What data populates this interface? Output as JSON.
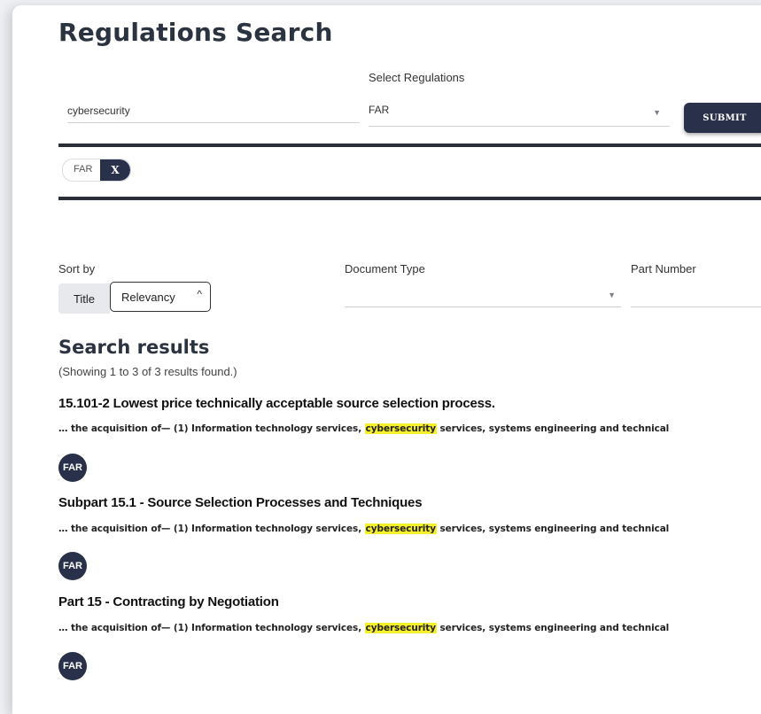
{
  "page": {
    "title": "Regulations Search"
  },
  "search": {
    "query": "cybersecurity",
    "regulations_label": "Select Regulations",
    "regulations_value": "FAR",
    "submit_label": "SUBMIT"
  },
  "filters": {
    "chips": [
      {
        "label": "FAR",
        "remove_label": "X"
      }
    ]
  },
  "sort": {
    "label": "Sort by",
    "title_option": "Title",
    "selected": "Relevancy"
  },
  "document_type": {
    "label": "Document Type",
    "value": ""
  },
  "part_number": {
    "label": "Part Number",
    "value": ""
  },
  "results": {
    "heading": "Search results",
    "summary": "(Showing 1 to 3 of 3 results found.)",
    "items": [
      {
        "title": "15.101-2 Lowest price technically acceptable source selection process.",
        "snippet_before": "… the acquisition of— (1) Information technology services, ",
        "snippet_highlight": "cybersecurity",
        "snippet_after": " services, systems engineering and technical",
        "badge": "FAR"
      },
      {
        "title": "Subpart 15.1 - Source Selection Processes and Techniques",
        "snippet_before": "… the acquisition of— (1) Information technology services, ",
        "snippet_highlight": "cybersecurity",
        "snippet_after": " services, systems engineering and technical",
        "badge": "FAR"
      },
      {
        "title": "Part 15 - Contracting by Negotiation",
        "snippet_before": "… the acquisition of— (1) Information technology services, ",
        "snippet_highlight": "cybersecurity",
        "snippet_after": " services, systems engineering and technical",
        "badge": "FAR"
      }
    ]
  }
}
